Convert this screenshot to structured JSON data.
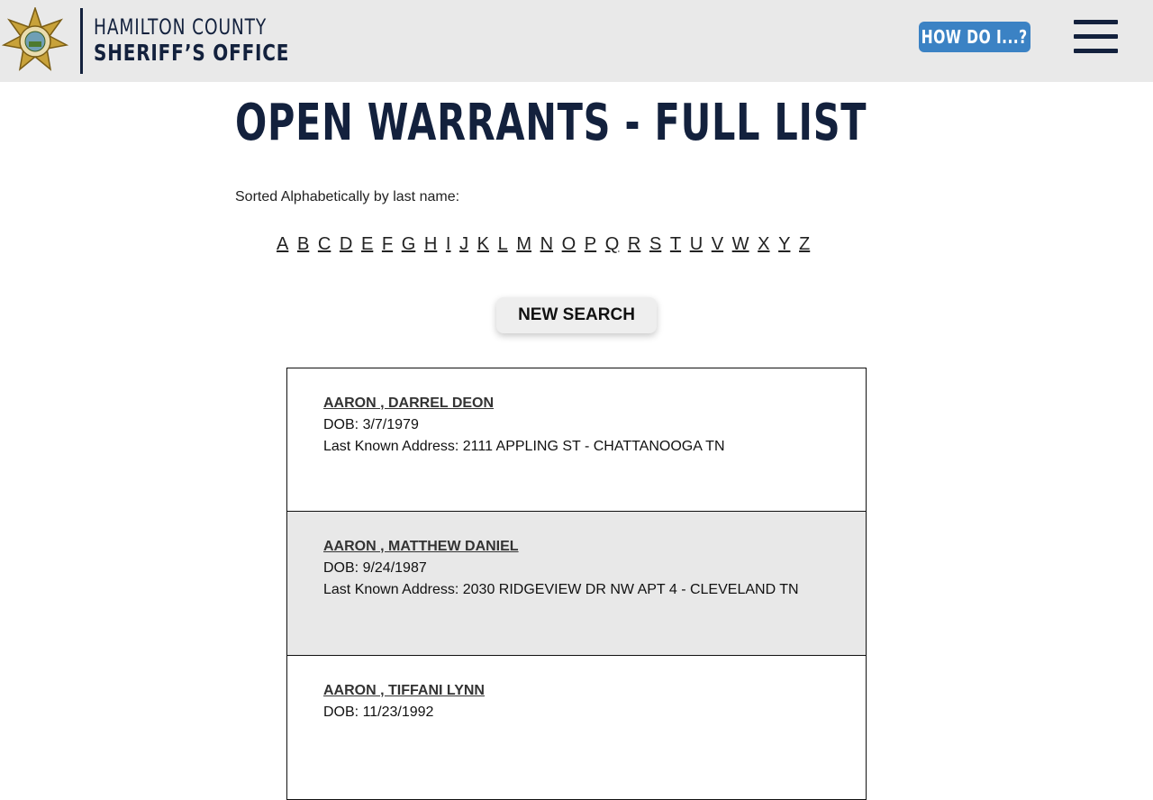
{
  "header": {
    "brand_line1": "HAMILTON COUNTY",
    "brand_line2": "SHERIFF’S OFFICE",
    "how_do_i": "HOW DO I...?",
    "menu_icon": "hamburger-menu-icon",
    "badge_icon": "sheriff-star-badge-icon",
    "colors": {
      "navy": "#13213d",
      "accent": "#3b82c4",
      "header_bg": "#e9e9e9"
    }
  },
  "main": {
    "title": "OPEN WARRANTS - FULL LIST",
    "sort_label": "Sorted Alphabetically by last name:",
    "letters": [
      "A",
      "B",
      "C",
      "D",
      "E",
      "F",
      "G",
      "H",
      "I",
      "J",
      "K",
      "L",
      "M",
      "N",
      "O",
      "P",
      "Q",
      "R",
      "S",
      "T",
      "U",
      "V",
      "W",
      "X",
      "Y",
      "Z"
    ],
    "new_search": "NEW SEARCH",
    "records": [
      {
        "name": "AARON , DARREL DEON",
        "dob": "DOB: 3/7/1979",
        "address": "Last Known Address: 2111 APPLING ST - CHATTANOOGA TN"
      },
      {
        "name": "AARON , MATTHEW DANIEL",
        "dob": "DOB: 9/24/1987",
        "address": "Last Known Address: 2030 RIDGEVIEW DR NW APT 4 - CLEVELAND TN"
      },
      {
        "name": "AARON , TIFFANI LYNN",
        "dob": "DOB: 11/23/1992",
        "address": ""
      }
    ]
  }
}
